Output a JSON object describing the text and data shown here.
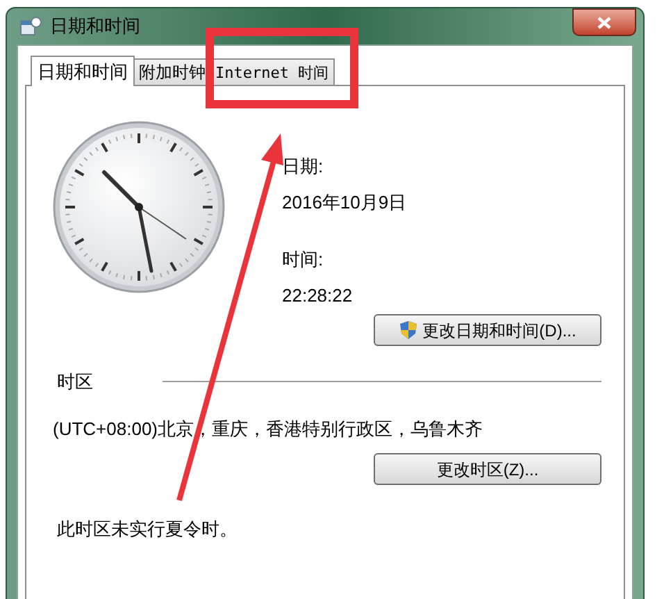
{
  "window": {
    "title": "日期和时间"
  },
  "tabs": [
    {
      "label": "日期和时间",
      "selected": true
    },
    {
      "label": "附加时钟",
      "selected": false
    },
    {
      "label": "Internet 时间",
      "selected": false
    }
  ],
  "date_label": "日期:",
  "date": "2016年10月9日",
  "time_label": "时间:",
  "time": "22:28:22",
  "change_datetime_button": "更改日期和时间(D)...",
  "timezone_section": "时区",
  "timezone": "(UTC+08:00)北京，重庆，香港特别行政区，乌鲁木齐",
  "change_timezone_button": "更改时区(Z)...",
  "dst_note": "此时区未实行夏令时。"
}
